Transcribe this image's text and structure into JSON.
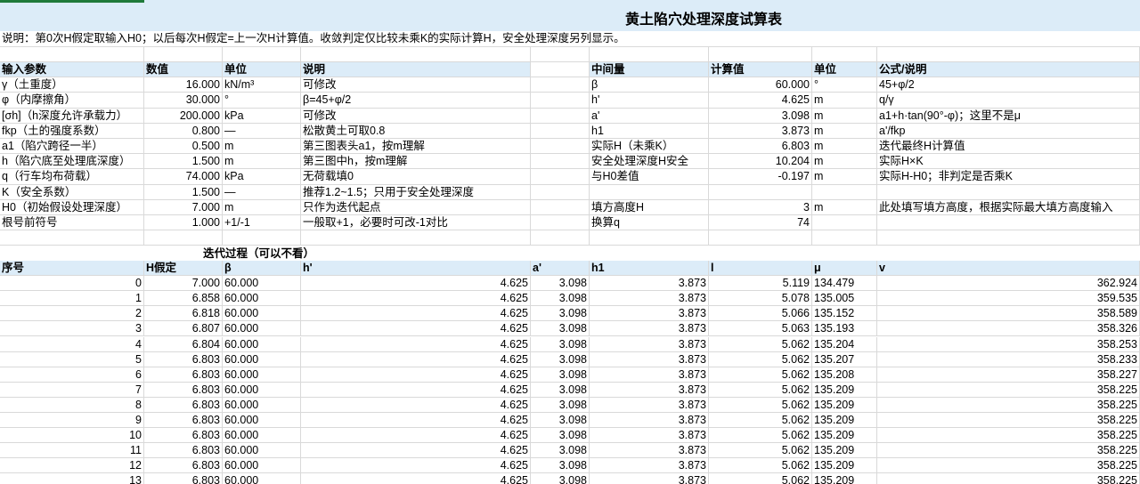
{
  "title": "黄土陷穴处理深度试算表",
  "note": "说明：第0次H假定取输入H0；以后每次H假定=上一次H计算值。收敛判定仅比较未乘K的实际计算H，安全处理深度另列显示。",
  "params": {
    "headers": [
      "输入参数",
      "数值",
      "单位",
      "说明",
      "",
      "中间量",
      "计算值",
      "单位",
      "公式/说明"
    ],
    "rows": [
      [
        "γ（土重度）",
        "16.000",
        "kN/m³",
        "可修改",
        "",
        "β",
        "60.000",
        "°",
        "45+φ/2"
      ],
      [
        "φ（内摩擦角）",
        "30.000",
        "°",
        "β=45+φ/2",
        "",
        "h'",
        "4.625",
        "m",
        "q/γ"
      ],
      [
        "[σh]（h深度允许承载力）",
        "200.000",
        "kPa",
        "可修改",
        "",
        "a'",
        "3.098",
        "m",
        "a1+h·tan(90°-φ)；这里不是μ"
      ],
      [
        "fkp（土的强度系数）",
        "0.800",
        "—",
        "松散黄土可取0.8",
        "",
        "h1",
        "3.873",
        "m",
        "a'/fkp"
      ],
      [
        "a1（陷穴跨径一半）",
        "0.500",
        "m",
        "第三图表头a1，按m理解",
        "",
        "实际H（未乘K）",
        "6.803",
        "m",
        "迭代最终H计算值"
      ],
      [
        "h（陷穴底至处理底深度）",
        "1.500",
        "m",
        "第三图中h，按m理解",
        "",
        "安全处理深度H安全",
        "10.204",
        "m",
        "实际H×K"
      ],
      [
        "q（行车均布荷载）",
        "74.000",
        "kPa",
        "无荷载填0",
        "",
        "与H0差值",
        "-0.197",
        "m",
        "实际H-H0；非判定是否乘K"
      ],
      [
        "K（安全系数）",
        "1.500",
        "—",
        "推荐1.2~1.5；只用于安全处理深度",
        "",
        "",
        "",
        "",
        ""
      ],
      [
        "H0（初始假设处理深度）",
        "7.000",
        "m",
        "只作为迭代起点",
        "",
        "填方高度H",
        "3",
        "m",
        "此处填写填方高度，根据实际最大填方高度输入"
      ],
      [
        "根号前符号",
        "1.000",
        "+1/-1",
        "一般取+1，必要时可改-1对比",
        "",
        "换算q",
        "74",
        "",
        ""
      ]
    ]
  },
  "iteration": {
    "title": "迭代过程（可以不看）",
    "headers": [
      "序号",
      "H假定",
      "β",
      "h'",
      "a'",
      "h1",
      "l",
      "μ",
      "v"
    ],
    "rows": [
      [
        "0",
        "7.000",
        "60.000",
        "4.625",
        "3.098",
        "3.873",
        "5.119",
        "134.479",
        "362.924"
      ],
      [
        "1",
        "6.858",
        "60.000",
        "4.625",
        "3.098",
        "3.873",
        "5.078",
        "135.005",
        "359.535"
      ],
      [
        "2",
        "6.818",
        "60.000",
        "4.625",
        "3.098",
        "3.873",
        "5.066",
        "135.152",
        "358.589"
      ],
      [
        "3",
        "6.807",
        "60.000",
        "4.625",
        "3.098",
        "3.873",
        "5.063",
        "135.193",
        "358.326"
      ],
      [
        "4",
        "6.804",
        "60.000",
        "4.625",
        "3.098",
        "3.873",
        "5.062",
        "135.204",
        "358.253"
      ],
      [
        "5",
        "6.803",
        "60.000",
        "4.625",
        "3.098",
        "3.873",
        "5.062",
        "135.207",
        "358.233"
      ],
      [
        "6",
        "6.803",
        "60.000",
        "4.625",
        "3.098",
        "3.873",
        "5.062",
        "135.208",
        "358.227"
      ],
      [
        "7",
        "6.803",
        "60.000",
        "4.625",
        "3.098",
        "3.873",
        "5.062",
        "135.209",
        "358.225"
      ],
      [
        "8",
        "6.803",
        "60.000",
        "4.625",
        "3.098",
        "3.873",
        "5.062",
        "135.209",
        "358.225"
      ],
      [
        "9",
        "6.803",
        "60.000",
        "4.625",
        "3.098",
        "3.873",
        "5.062",
        "135.209",
        "358.225"
      ],
      [
        "10",
        "6.803",
        "60.000",
        "4.625",
        "3.098",
        "3.873",
        "5.062",
        "135.209",
        "358.225"
      ],
      [
        "11",
        "6.803",
        "60.000",
        "4.625",
        "3.098",
        "3.873",
        "5.062",
        "135.209",
        "358.225"
      ],
      [
        "12",
        "6.803",
        "60.000",
        "4.625",
        "3.098",
        "3.873",
        "5.062",
        "135.209",
        "358.225"
      ],
      [
        "13",
        "6.803",
        "60.000",
        "4.625",
        "3.098",
        "3.873",
        "5.062",
        "135.209",
        "358.225"
      ]
    ]
  },
  "colors": {
    "header_fill": "#dcecf8",
    "sheet_tab": "#1f7a3a",
    "grid": "#d9d9d9"
  }
}
